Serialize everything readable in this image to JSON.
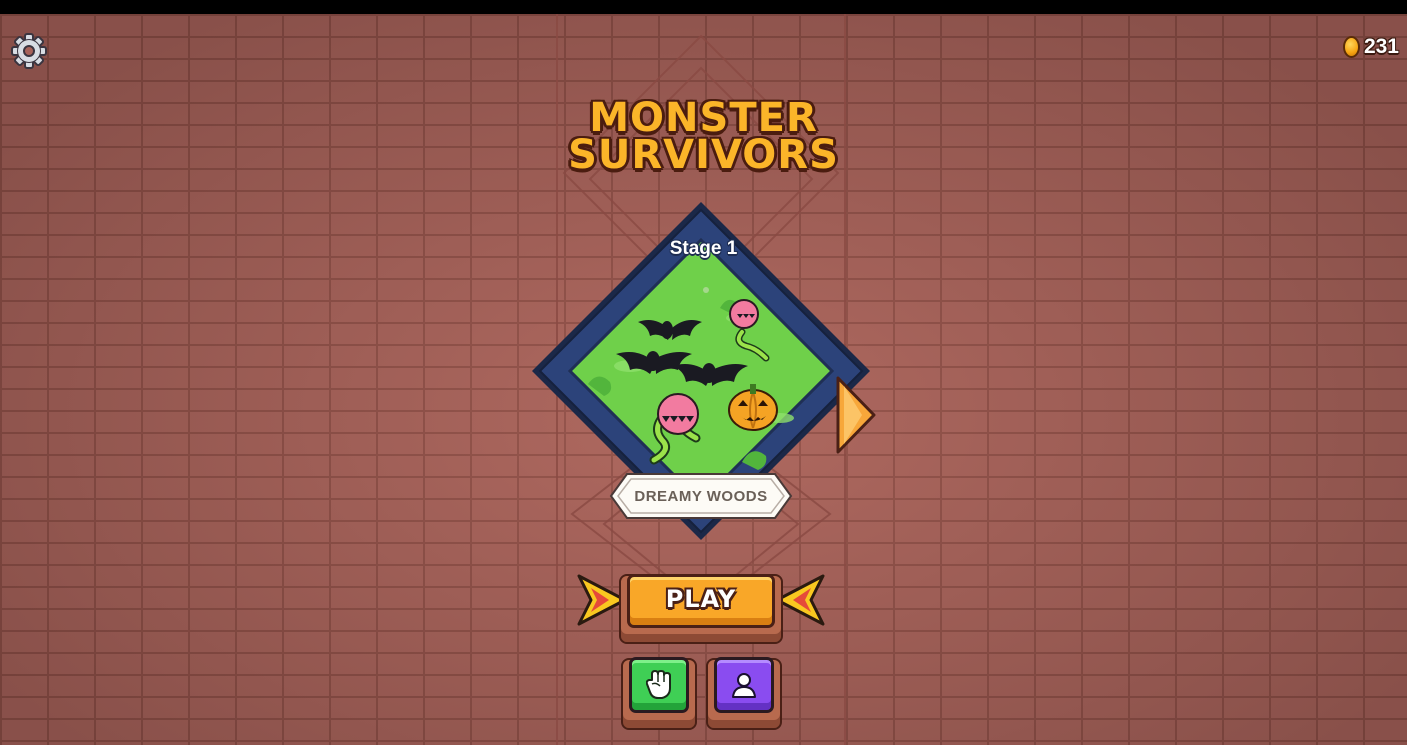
{
  "currency": {
    "amount": "231",
    "icon": "coin-icon"
  },
  "title": {
    "line1": "MONSTER",
    "line2": "SURVIVORS"
  },
  "stage": {
    "label": "Stage 1",
    "name": "DREAMY WOODS",
    "monsters": [
      "bat",
      "bat",
      "bat",
      "piranha-plant",
      "piranha-plant",
      "pumpkin"
    ]
  },
  "buttons": {
    "play": "PLAY",
    "settings_icon": "gear-icon",
    "next_stage_icon": "arrow-right-icon",
    "powerups_icon": "fist-icon",
    "characters_icon": "person-icon"
  },
  "colors": {
    "brick": "#a7625a",
    "title": "#fbb529",
    "play": "#f9a728",
    "green_button": "#3fcf55",
    "purple_button": "#8a4cf0",
    "stage_frame": "#283e72",
    "grass": "#6fd04a"
  }
}
